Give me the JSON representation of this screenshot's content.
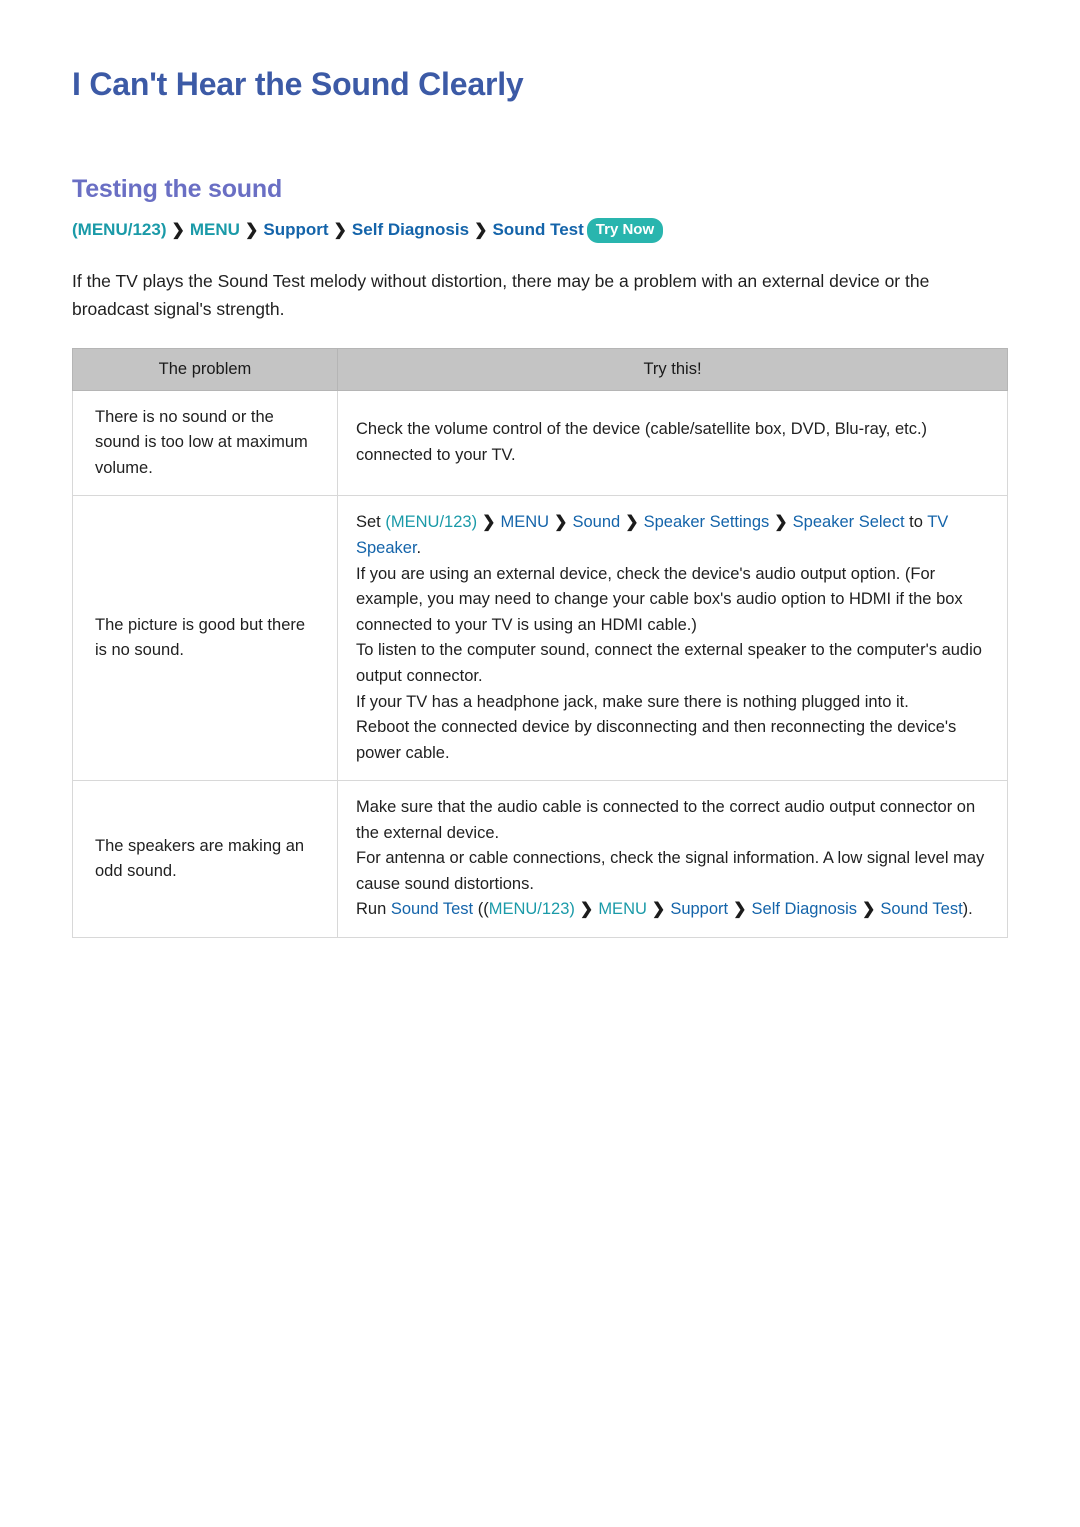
{
  "page": {
    "title": "I Can't Hear the Sound Clearly",
    "section_heading": "Testing the sound",
    "intro": "If the TV plays the Sound Test melody without distortion, there may be a problem with an external device or the broadcast signal's strength."
  },
  "colors": {
    "title": "#3c5aa6",
    "section_heading": "#6a6fc4",
    "teal_link": "#1a9aa8",
    "blue_link": "#1464aa",
    "badge_bg": "#29b5ae",
    "table_header_bg": "#c4c4c4"
  },
  "breadcrumb": {
    "open_paren": "(",
    "menu123": "MENU/123",
    "close_paren": ")",
    "arrow": "❯",
    "items": [
      "MENU",
      "Support",
      "Self Diagnosis",
      "Sound Test"
    ],
    "badge": "Try Now"
  },
  "table": {
    "headers": [
      "The problem",
      "Try this!"
    ],
    "rows": [
      {
        "problem": "There is no sound or the sound is too low at maximum volume.",
        "answer_lines": [
          "Check the volume control of the device (cable/satellite box, DVD, Blu-ray, etc.) connected to your TV."
        ]
      },
      {
        "problem": "The picture is good but there is no sound.",
        "path_prefix": "Set ",
        "path_open_paren": "(",
        "path_menu123": "MENU/123",
        "path_close_paren": ")",
        "path_items": [
          "MENU",
          "Sound",
          "Speaker Settings",
          "Speaker Select"
        ],
        "path_mid": " to ",
        "path_target": "TV Speaker",
        "path_suffix": ".",
        "answer_lines": [
          "If you are using an external device, check the device's audio output option. (For example, you may need to change your cable box's audio option to HDMI if the box connected to your TV is using an HDMI cable.)",
          "To listen to the computer sound, connect the external speaker to the computer's audio output connector.",
          "If your TV has a headphone jack, make sure there is nothing plugged into it.",
          "Reboot the connected device by disconnecting and then reconnecting the device's power cable."
        ]
      },
      {
        "problem": "The speakers are making an odd sound.",
        "answer_lines": [
          "Make sure that the audio cable is connected to the correct audio output connector on the external device.",
          "For antenna or cable connections, check the signal information. A low signal level may cause sound distortions."
        ],
        "run_prefix": "Run ",
        "run_link": "Sound Test",
        "run_open": " ((",
        "run_menu123": "MENU/123",
        "run_close_paren": ")",
        "run_items": [
          "MENU",
          "Support",
          "Self Diagnosis",
          "Sound Test"
        ],
        "run_suffix": ")."
      }
    ]
  }
}
